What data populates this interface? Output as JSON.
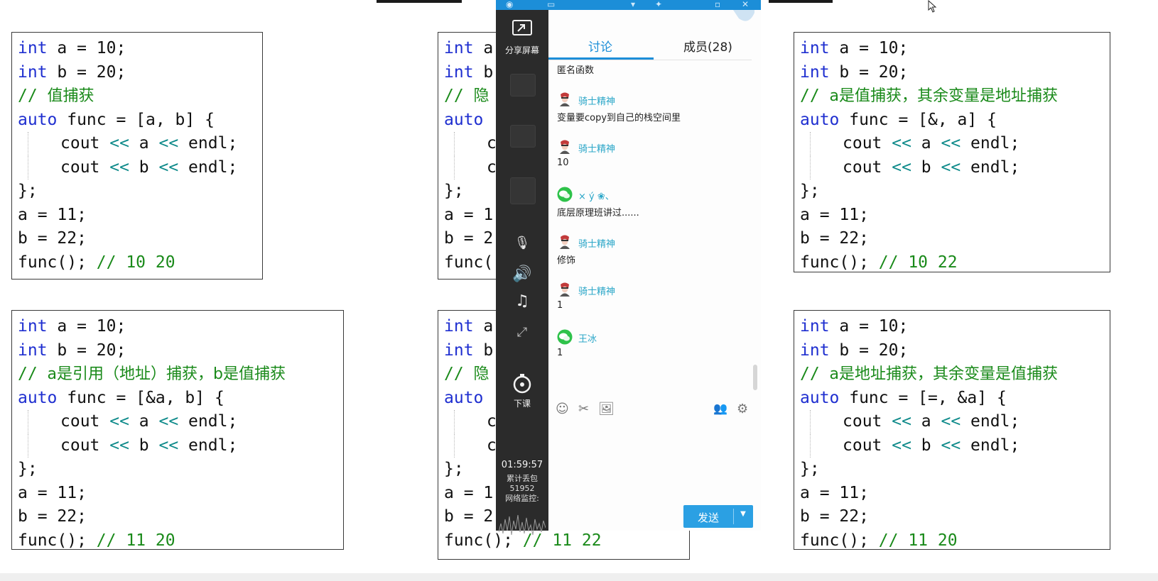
{
  "code_panels": [
    {
      "lines": [
        [
          [
            "kw",
            "int"
          ],
          [
            "t",
            " a = 10;"
          ]
        ],
        [
          [
            "kw",
            "int"
          ],
          [
            "t",
            " b = 20;"
          ]
        ],
        [
          [
            "cm",
            "// "
          ],
          [
            "cmz",
            "值捕获"
          ]
        ],
        [
          [
            "kw",
            "auto"
          ],
          [
            "t",
            " func = [a, b] {"
          ]
        ],
        [
          [
            "ind",
            ""
          ],
          [
            "t",
            "cout "
          ],
          [
            "op",
            "<<"
          ],
          [
            "t",
            " a "
          ],
          [
            "op",
            "<<"
          ],
          [
            "t",
            " endl;"
          ]
        ],
        [
          [
            "ind",
            ""
          ],
          [
            "t",
            "cout "
          ],
          [
            "op",
            "<<"
          ],
          [
            "t",
            " b "
          ],
          [
            "op",
            "<<"
          ],
          [
            "t",
            " endl;"
          ]
        ],
        [
          [
            "t",
            "};"
          ]
        ],
        [
          [
            "t",
            "a = 11;"
          ]
        ],
        [
          [
            "t",
            "b = 22;"
          ]
        ],
        [
          [
            "t",
            "func(); "
          ],
          [
            "cm",
            "// 10 20"
          ]
        ]
      ]
    },
    {
      "lines": [
        [
          [
            "kw",
            "int"
          ],
          [
            "t",
            " a"
          ]
        ],
        [
          [
            "kw",
            "int"
          ],
          [
            "t",
            " b"
          ]
        ],
        [
          [
            "cm",
            "// "
          ],
          [
            "cmz",
            "隐"
          ]
        ],
        [
          [
            "kw",
            "auto"
          ]
        ],
        [
          [
            "ind",
            ""
          ],
          [
            "t",
            "c"
          ]
        ],
        [
          [
            "ind",
            ""
          ],
          [
            "t",
            "c"
          ]
        ],
        [
          [
            "t",
            "};"
          ]
        ],
        [
          [
            "t",
            "a = 1"
          ]
        ],
        [
          [
            "t",
            "b = 2"
          ]
        ],
        [
          [
            "t",
            "func("
          ]
        ]
      ]
    },
    {
      "lines": [
        [
          [
            "kw",
            "int"
          ],
          [
            "t",
            " a = 10;"
          ]
        ],
        [
          [
            "kw",
            "int"
          ],
          [
            "t",
            " b = 20;"
          ]
        ],
        [
          [
            "cm",
            "// "
          ],
          [
            "cmz",
            "a是值捕获，其余变量是地址捕获"
          ]
        ],
        [
          [
            "kw",
            "auto"
          ],
          [
            "t",
            " func = [&, a] {"
          ]
        ],
        [
          [
            "ind",
            ""
          ],
          [
            "t",
            "cout "
          ],
          [
            "op",
            "<<"
          ],
          [
            "t",
            " a "
          ],
          [
            "op",
            "<<"
          ],
          [
            "t",
            " endl;"
          ]
        ],
        [
          [
            "ind",
            ""
          ],
          [
            "t",
            "cout "
          ],
          [
            "op",
            "<<"
          ],
          [
            "t",
            " b "
          ],
          [
            "op",
            "<<"
          ],
          [
            "t",
            " endl;"
          ]
        ],
        [
          [
            "t",
            "};"
          ]
        ],
        [
          [
            "t",
            "a = 11;"
          ]
        ],
        [
          [
            "t",
            "b = 22;"
          ]
        ],
        [
          [
            "t",
            "func(); "
          ],
          [
            "cm",
            "// 10 22"
          ]
        ]
      ]
    },
    {
      "lines": [
        [
          [
            "kw",
            "int"
          ],
          [
            "t",
            " a = 10;"
          ]
        ],
        [
          [
            "kw",
            "int"
          ],
          [
            "t",
            " b = 20;"
          ]
        ],
        [
          [
            "cm",
            "// "
          ],
          [
            "cmz",
            "a是引用（地址）捕获，b是值捕获"
          ]
        ],
        [
          [
            "kw",
            "auto"
          ],
          [
            "t",
            " func = [&a, b] {"
          ]
        ],
        [
          [
            "ind",
            ""
          ],
          [
            "t",
            "cout "
          ],
          [
            "op",
            "<<"
          ],
          [
            "t",
            " a "
          ],
          [
            "op",
            "<<"
          ],
          [
            "t",
            " endl;"
          ]
        ],
        [
          [
            "ind",
            ""
          ],
          [
            "t",
            "cout "
          ],
          [
            "op",
            "<<"
          ],
          [
            "t",
            " b "
          ],
          [
            "op",
            "<<"
          ],
          [
            "t",
            " endl;"
          ]
        ],
        [
          [
            "t",
            "};"
          ]
        ],
        [
          [
            "t",
            "a = 11;"
          ]
        ],
        [
          [
            "t",
            "b = 22;"
          ]
        ],
        [
          [
            "t",
            "func(); "
          ],
          [
            "cm",
            "// 11 20"
          ]
        ]
      ]
    },
    {
      "lines": [
        [
          [
            "kw",
            "int"
          ],
          [
            "t",
            " a"
          ]
        ],
        [
          [
            "kw",
            "int"
          ],
          [
            "t",
            " b"
          ]
        ],
        [
          [
            "cm",
            "// "
          ],
          [
            "cmz",
            "隐"
          ]
        ],
        [
          [
            "kw",
            "auto"
          ]
        ],
        [
          [
            "ind",
            ""
          ],
          [
            "t",
            "c"
          ]
        ],
        [
          [
            "ind",
            ""
          ],
          [
            "t",
            "c"
          ]
        ],
        [
          [
            "t",
            "};"
          ]
        ],
        [
          [
            "t",
            "a = 1"
          ]
        ],
        [
          [
            "t",
            "b = 2"
          ]
        ],
        [
          [
            "t",
            "func(); "
          ],
          [
            "cm",
            "// 11 22"
          ]
        ]
      ]
    },
    {
      "lines": [
        [
          [
            "kw",
            "int"
          ],
          [
            "t",
            " a = 10;"
          ]
        ],
        [
          [
            "kw",
            "int"
          ],
          [
            "t",
            " b = 20;"
          ]
        ],
        [
          [
            "cm",
            "// "
          ],
          [
            "cmz",
            "a是地址捕获，其余变量是值捕获"
          ]
        ],
        [
          [
            "kw",
            "auto"
          ],
          [
            "t",
            " func = [=, &a] {"
          ]
        ],
        [
          [
            "ind",
            ""
          ],
          [
            "t",
            "cout "
          ],
          [
            "op",
            "<<"
          ],
          [
            "t",
            " a "
          ],
          [
            "op",
            "<<"
          ],
          [
            "t",
            " endl;"
          ]
        ],
        [
          [
            "ind",
            ""
          ],
          [
            "t",
            "cout "
          ],
          [
            "op",
            "<<"
          ],
          [
            "t",
            " b "
          ],
          [
            "op",
            "<<"
          ],
          [
            "t",
            " endl;"
          ]
        ],
        [
          [
            "t",
            "};"
          ]
        ],
        [
          [
            "t",
            "a = 11;"
          ]
        ],
        [
          [
            "t",
            "b = 22;"
          ]
        ],
        [
          [
            "t",
            "func(); "
          ],
          [
            "cm",
            "// 11 20"
          ]
        ]
      ]
    }
  ],
  "chat": {
    "sidebar": {
      "share_screen": "分享屏幕",
      "end_class": "下课",
      "timer": "01:59:57",
      "packet_loss_label": "累计丢包",
      "packet_loss_value": "51952",
      "network_monitor": "网络监控:"
    },
    "tabs": {
      "discussion": "讨论",
      "members": "成员(28)"
    },
    "messages": [
      {
        "text": "匿名函数"
      },
      {
        "sender": "骑士精神",
        "avatar": "knight",
        "text": "变量要copy到自己的栈空间里"
      },
      {
        "sender": "骑士精神",
        "avatar": "knight",
        "text": "10"
      },
      {
        "sender": "× ý ❀、",
        "avatar": "wechat",
        "text": "底层原理班讲过......"
      },
      {
        "sender": "骑士精神",
        "avatar": "knight",
        "text": "修饰"
      },
      {
        "sender": "骑士精神",
        "avatar": "knight",
        "text": "1"
      },
      {
        "sender": "王冰",
        "avatar": "wechat",
        "text": "1"
      }
    ],
    "send_label": "发送",
    "colors": {
      "accent": "#1c8ed8",
      "sidebar": "#2b2b2b",
      "sender_name": "#2aa6c8"
    }
  }
}
